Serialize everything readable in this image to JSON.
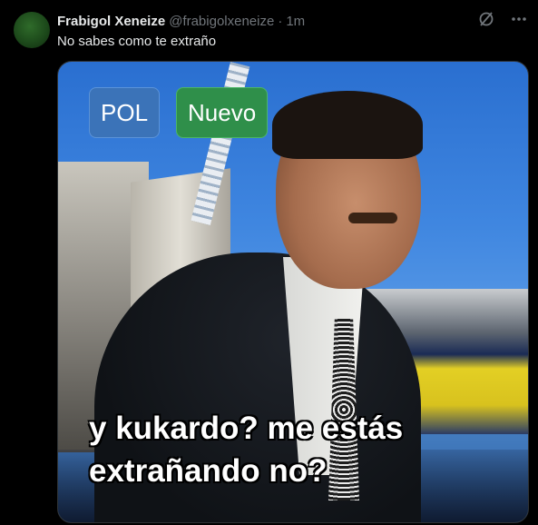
{
  "tweet": {
    "display_name": "Frabigol Xeneize",
    "handle": "@frabigolxeneize",
    "separator": "·",
    "time": "1m",
    "text": "No sabes como te extraño"
  },
  "actions": [
    {
      "icon": "grok-icon"
    },
    {
      "icon": "more-icon"
    }
  ],
  "media": {
    "badges": [
      "POL",
      "Nuevo"
    ],
    "caption_line1": "y kukardo? me estás",
    "caption_line2": "extrañando no?"
  },
  "colors": {
    "background": "#000000",
    "text_primary": "#e7e9ea",
    "text_secondary": "#71767b",
    "badge_pol": "#3b73b8",
    "badge_new": "#2f8f4a"
  }
}
